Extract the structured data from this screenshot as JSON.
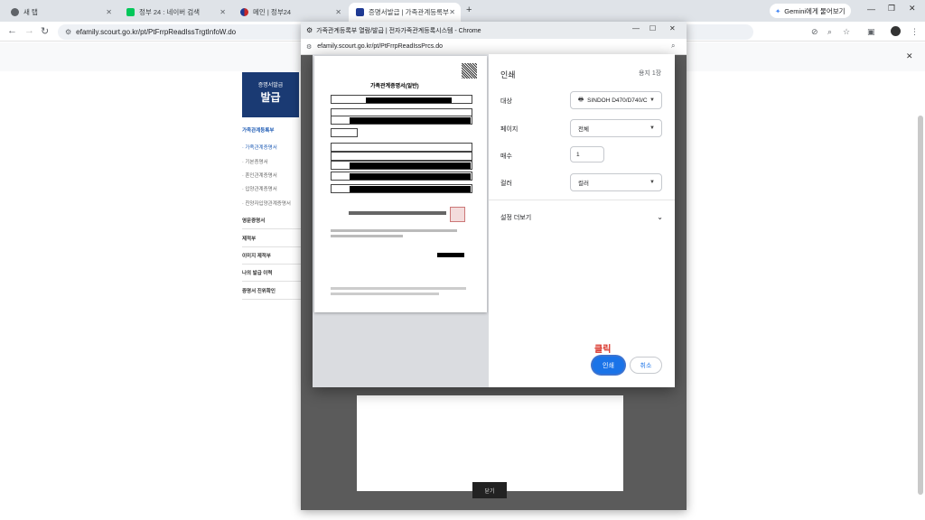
{
  "tabs": [
    {
      "label": "새 탭",
      "fav_color": "#5f6368"
    },
    {
      "label": "정부 24 : 네이버 검색",
      "fav_color": "#03c75a"
    },
    {
      "label": "메인 | 정부24",
      "fav_color": "#c62828"
    },
    {
      "label": "증명서발급 | 가족관계등록부",
      "fav_color": "#1f3a93"
    }
  ],
  "new_tab": "+",
  "gemini": "Gemini에게 물어보기",
  "address": {
    "url": "efamily.scourt.go.kr/pt/PtFrrpReadIssTrgtInfoW.do"
  },
  "sidebar": {
    "logo_line1": "증명서발급",
    "logo_line2": "발급",
    "items": [
      "가족관계등록부",
      "· 가족관계증명서",
      "· 기본증명서",
      "· 혼인관계증명서",
      "· 입양관계증명서",
      "· 친양자입양관계증명서",
      "영문증명서",
      "제적부",
      "이미지 제적부",
      "나의 발급 이력",
      "증명서 진위확인"
    ]
  },
  "popup": {
    "title": "가족관계등록부 열람/발급 | 전자가족관계등록시스템 - Chrome",
    "url": "efamily.scourt.go.kr/pt/PtFrrpReadIssPrcs.do",
    "close_label": "닫기"
  },
  "print": {
    "heading": "인쇄",
    "sheet_count": "용지 1장",
    "destination_label": "대상",
    "destination_value": "SINDOH D470/D740/C",
    "pages_label": "페이지",
    "pages_value": "전체",
    "copies_label": "매수",
    "copies_value": "1",
    "color_label": "컬러",
    "color_value": "컬러",
    "more_settings": "설정 더보기",
    "print_button": "인쇄",
    "cancel_button": "취소",
    "click_note": "클릭"
  },
  "preview": {
    "doc_title": "가족관계증명서(일반)"
  }
}
